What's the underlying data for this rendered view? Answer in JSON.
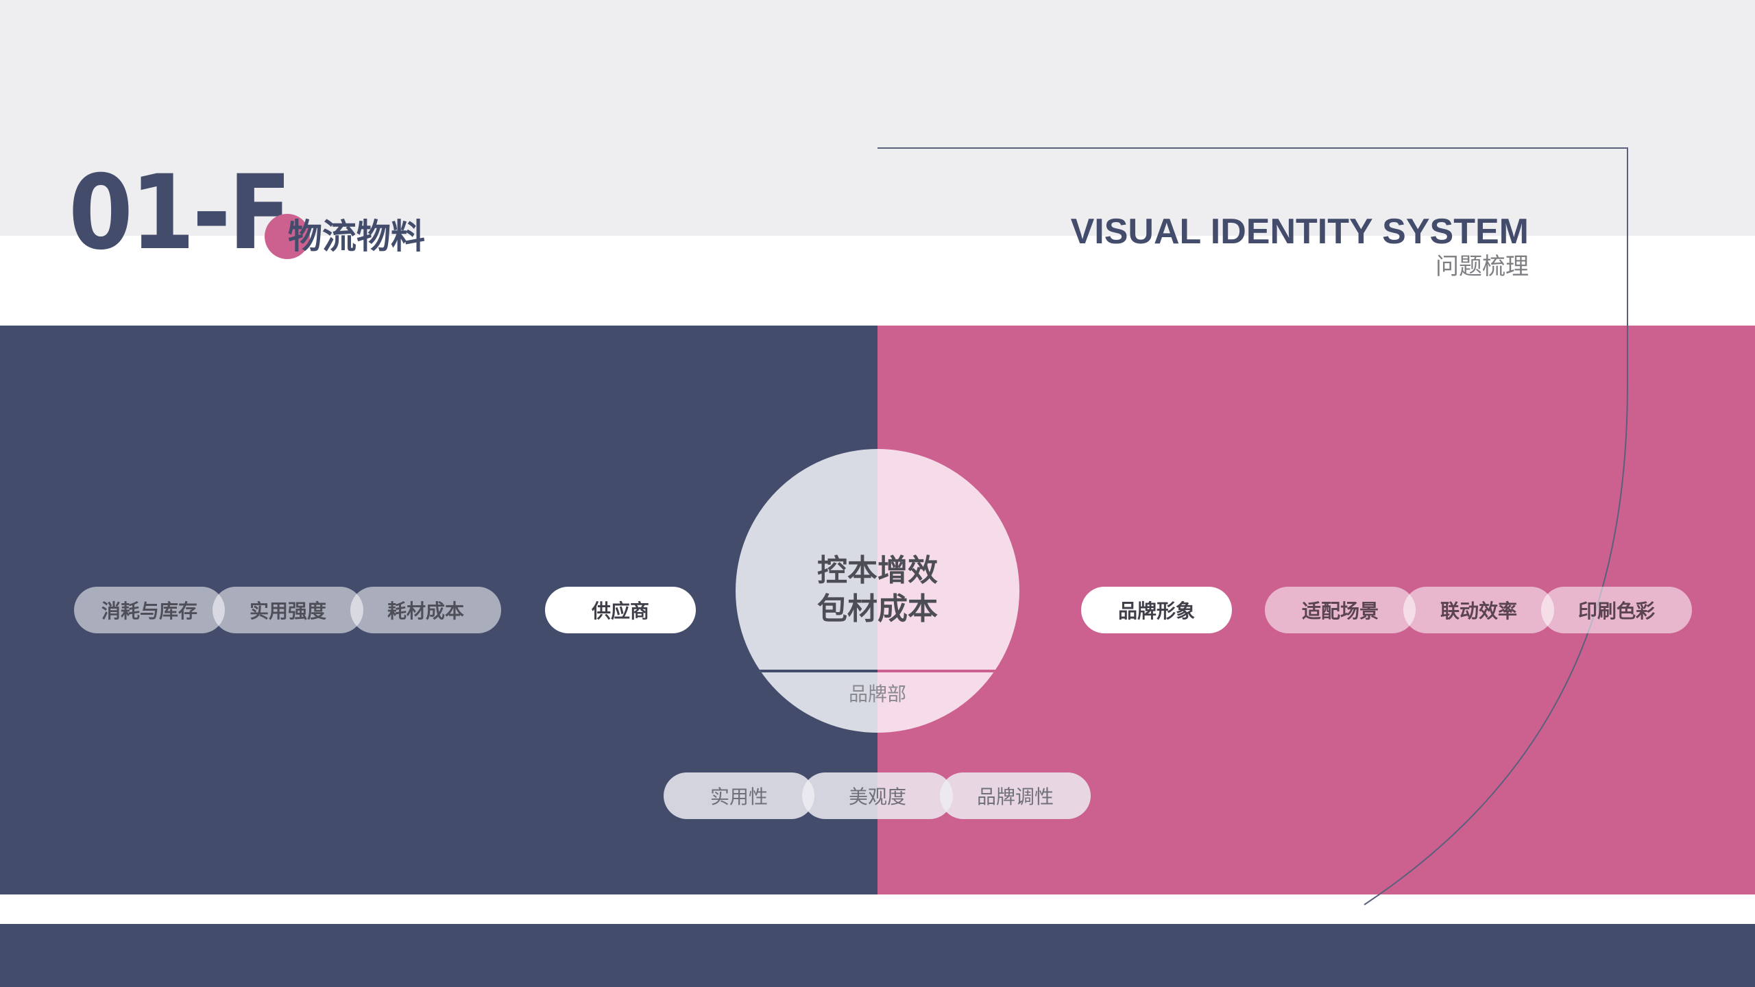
{
  "header": {
    "code": "01-F",
    "section_title": "物流物料",
    "brand_title": "VISUAL IDENTITY SYSTEM",
    "brand_subtitle": "问题梳理"
  },
  "left_group": {
    "pills": [
      "消耗与库存",
      "实用强度",
      "耗材成本"
    ],
    "main_pill": "供应商"
  },
  "right_group": {
    "main_pill": "品牌形象",
    "pills": [
      "适配场景",
      "联动效率",
      "印刷色彩"
    ]
  },
  "center": {
    "line1": "控本增效",
    "line2": "包材成本",
    "department": "品牌部"
  },
  "bottom_pills": [
    "实用性",
    "美观度",
    "品牌调性"
  ],
  "colors": {
    "navy": "#434c6b",
    "pink": "#cc6190",
    "light_gray": "#eeeef1"
  }
}
